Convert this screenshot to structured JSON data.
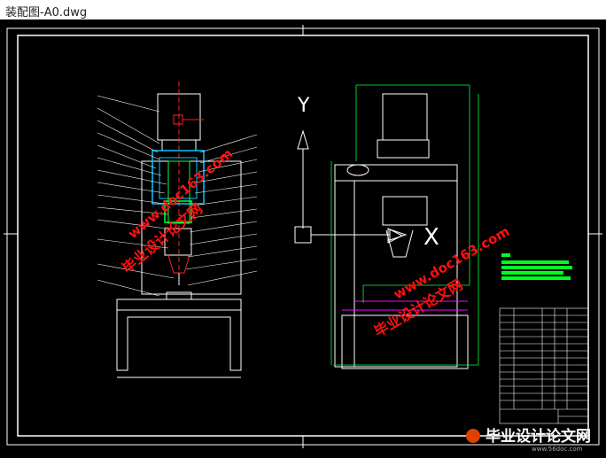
{
  "window": {
    "title": "装配图-A0.dwg"
  },
  "axis_icon": {
    "y_label": "Y",
    "x_label": "X"
  },
  "watermarks": [
    {
      "text": "www.doc163.com"
    },
    {
      "text": "毕业设计论文网"
    }
  ],
  "footer_brand": {
    "text": "毕业设计论文网",
    "url": "www.56doc.com"
  },
  "colors": {
    "background": "#000000",
    "frame": "#ffffff",
    "machine": "#ffffff",
    "section_cyan": "#00c8ff",
    "section_green": "#00ff40",
    "leader_lines": "#ffffff",
    "magenta_line": "#ff00ff",
    "motor_mark": "#ff2020",
    "watermark_red": "#ff1010",
    "notes_green": "#00ff20"
  }
}
